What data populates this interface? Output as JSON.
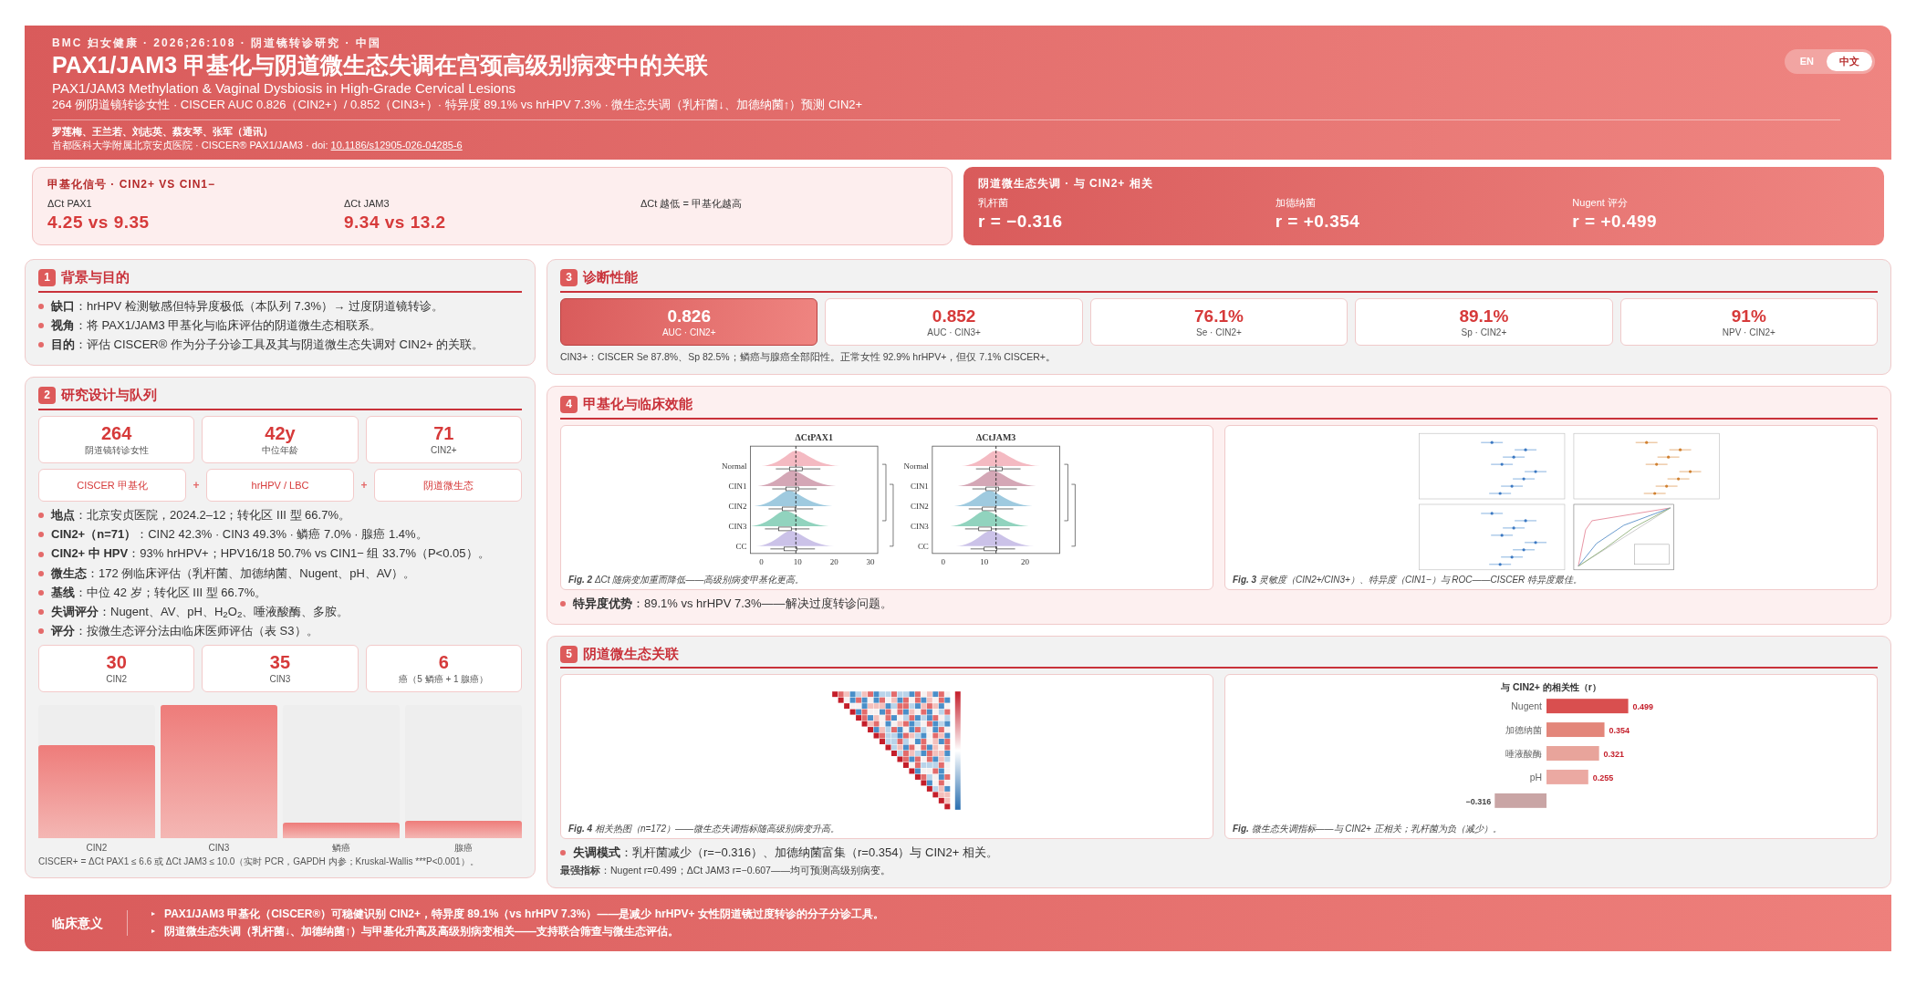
{
  "header": {
    "kicker": "BMC 妇女健康 · 2026;26:108 · 阴道镜转诊研究 · 中国",
    "title": "PAX1/JAM3 甲基化与阴道微生态失调在宫颈高级别病变中的关联",
    "subtitle": "PAX1/JAM3 Methylation & Vaginal Dysbiosis in High-Grade Cervical Lesions",
    "summary": "264 例阴道镜转诊女性 · CISCER AUC 0.826（CIN2+）/ 0.852（CIN3+）· 特异度 89.1% vs hrHPV 7.3% · 微生态失调（乳杆菌↓、加德纳菌↑）预测 CIN2+",
    "authors": "罗莲梅、王兰若、刘志英、蔡友琴、张军（通讯）",
    "affiliation": "首都医科大学附属北京安贞医院 · CISCER® PAX1/JAM3 · doi:",
    "doi": "10.1186/s12905-026-04285-6"
  },
  "language_toggle": [
    {
      "label": "EN",
      "selected": false
    },
    {
      "label": "中文",
      "selected": true
    }
  ],
  "highlight_cards": [
    {
      "kind": "light",
      "title": "甲基化信号 · CIN2+ VS CIN1−",
      "items": [
        {
          "label": "ΔCt PAX1",
          "value": "4.25 vs 9.35"
        },
        {
          "label": "ΔCt JAM3",
          "value": "9.34 vs 13.2"
        },
        {
          "label": "ΔCt 越低 = 甲基化越高"
        }
      ]
    },
    {
      "kind": "accent",
      "title": "阴道微生态失调 · 与 CIN2+ 相关",
      "items": [
        {
          "label": "乳杆菌",
          "value": "r = −0.316"
        },
        {
          "label": "加德纳菌",
          "value": "r = +0.354"
        },
        {
          "label": "Nugent 评分",
          "value": "r = +0.499"
        }
      ]
    }
  ],
  "background": {
    "number": "1",
    "title": "背景与目的",
    "bullets": [
      "**缺口**：hrHPV 检测敏感但特异度极低（本队列 7.3%）→ 过度阴道镜转诊。",
      "**视角**：将 PAX1/JAM3 甲基化与临床评估的阴道微生态相联系。",
      "**目的**：评估 CISCER® 作为分子分诊工具及其与阴道微生态失调对 CIN2+ 的关联。"
    ]
  },
  "design": {
    "number": "2",
    "title": "研究设计与队列",
    "stats": [
      {
        "value": "264",
        "label": "阴道镜转诊女性"
      },
      {
        "value": "42y",
        "label": "中位年龄"
      },
      {
        "value": "71",
        "label": "CIN2+"
      }
    ],
    "components": [
      "CISCER 甲基化",
      "hrHPV / LBC",
      "阴道微生态"
    ],
    "joiners": [
      "+",
      "+"
    ],
    "bullets": [
      "**地点**：北京安贞医院，2024.2–12；转化区 III 型 66.7%。",
      "**CIN2+（n=71）**：CIN2 42.3% · CIN3 49.3% · 鳞癌 7.0% · 腺癌 1.4%。",
      "**CIN2+ 中 HPV**：93% hrHPV+；HPV16/18 50.7% vs CIN1− 组 33.7%（P<0.05）。",
      "**微生态**：172 例临床评估（乳杆菌、加德纳菌、Nugent、pH、AV）。",
      "**基线**：中位 42 岁；转化区 III 型 66.7%。",
      "**失调评分**：Nugent、AV、pH、H$_{2}$O$_{2}$、唾液酸酶、多胺。",
      "**评分**：按微生态评分法由临床医师评估（表 S3）。"
    ],
    "grade_stats": [
      {
        "value": "30",
        "label": "CIN2"
      },
      {
        "value": "35",
        "label": "CIN3"
      },
      {
        "value": "6",
        "label": "癌（5 鳞癌 + 1 腺癌）"
      }
    ],
    "distribution": [
      {
        "label": "CIN2",
        "level": 0.7
      },
      {
        "label": "CIN3",
        "level": 1.0
      },
      {
        "label": "鳞癌",
        "level": 0.12
      },
      {
        "label": "腺癌",
        "level": 0.13
      }
    ],
    "footnote": "CISCER+ = ΔCt PAX1 ≤ 6.6 或 ΔCt JAM3 ≤ 10.0（实时 PCR，GAPDH 内参；Kruskal-Wallis ***P<0.001）。"
  },
  "performance": {
    "number": "3",
    "title": "诊断性能",
    "metrics": [
      {
        "value": "0.826",
        "label": "AUC · CIN2+",
        "selected": true
      },
      {
        "value": "0.852",
        "label": "AUC · CIN3+",
        "selected": false
      },
      {
        "value": "76.1%",
        "label": "Se · CIN2+",
        "selected": false
      },
      {
        "value": "89.1%",
        "label": "Sp · CIN2+",
        "selected": false
      },
      {
        "value": "91%",
        "label": "NPV · CIN2+",
        "selected": false
      }
    ],
    "note": "CIN3+：CISCER Se 87.8%、Sp 82.5%；鳞癌与腺癌全部阳性。正常女性 92.9% hrHPV+，但仅 7.1% CISCER+。"
  },
  "methylation": {
    "number": "4",
    "title": "甲基化与临床效能",
    "figures": [
      {
        "kind": "ridgeline",
        "panels": [
          {
            "title": "ΔCtPAX1",
            "groups": [
              "Normal",
              "CIN1",
              "CIN2",
              "CIN3",
              "CC"
            ],
            "ticks": [
              "0",
              "10",
              "20",
              "30"
            ]
          },
          {
            "title": "ΔCtJAM3",
            "groups": [
              "Normal",
              "CIN1",
              "CIN2",
              "CIN3",
              "CC"
            ],
            "ticks": [
              "0",
              "10",
              "20"
            ]
          }
        ],
        "caption": "**Fig. 2** ΔCt 随病变加重而降低——高级别病变甲基化更高。"
      },
      {
        "kind": "forest",
        "caption": "**Fig. 3** 灵敏度（CIN2+/CIN3+）、特异度（CIN1−）与 ROC——CISCER 特异度最佳。"
      }
    ],
    "bullets": [
      "**特异度优势**：89.1% vs hrHPV 7.3%——解决过度转诊问题。"
    ]
  },
  "microbiome": {
    "number": "5",
    "title": "阴道微生态关联",
    "figures": [
      {
        "kind": "heatmap",
        "caption": "**Fig. 4** 相关热图（n=172）——微生态失调指标随高级别病变升高。"
      },
      {
        "kind": "bars",
        "chart_data": {
          "type": "bar",
          "orientation": "horizontal",
          "title": "与 CIN2+ 的相关性（r）",
          "categories": [
            "Nugent",
            "加德纳菌",
            "唾液酸酶",
            "pH",
            null
          ],
          "values": [
            0.499,
            0.354,
            0.321,
            0.255,
            -0.316
          ],
          "value_labels": [
            "0.499",
            "0.354",
            "0.321",
            "0.255",
            "−0.316"
          ]
        },
        "caption": "**Fig.** 微生态失调指标——与 CIN2+ 正相关；乳杆菌为负（减少）。"
      }
    ],
    "bullets": [
      "**失调模式**：乳杆菌减少（r=−0.316）、加德纳菌富集（r=0.354）与 CIN2+ 相关。"
    ],
    "note": "**最强指标**：Nugent r=0.499；ΔCt JAM3 r=−0.607——均可预测高级别病变。"
  },
  "clinical_significance": {
    "label": "临床意义",
    "points": [
      {
        "marker": "▸",
        "text": "PAX1/JAM3 甲基化（CISCER®）可稳健识别 CIN2+，特异度 89.1%（vs hrHPV 7.3%）——是减少 hrHPV+ 女性阴道镜过度转诊的分子分诊工具。"
      },
      {
        "marker": "▸",
        "text": "阴道微生态失调（乳杆菌↓、加德纳菌↑）与甲基化升高及高级别病变相关——支持联合筛查与微生态评估。"
      }
    ]
  }
}
